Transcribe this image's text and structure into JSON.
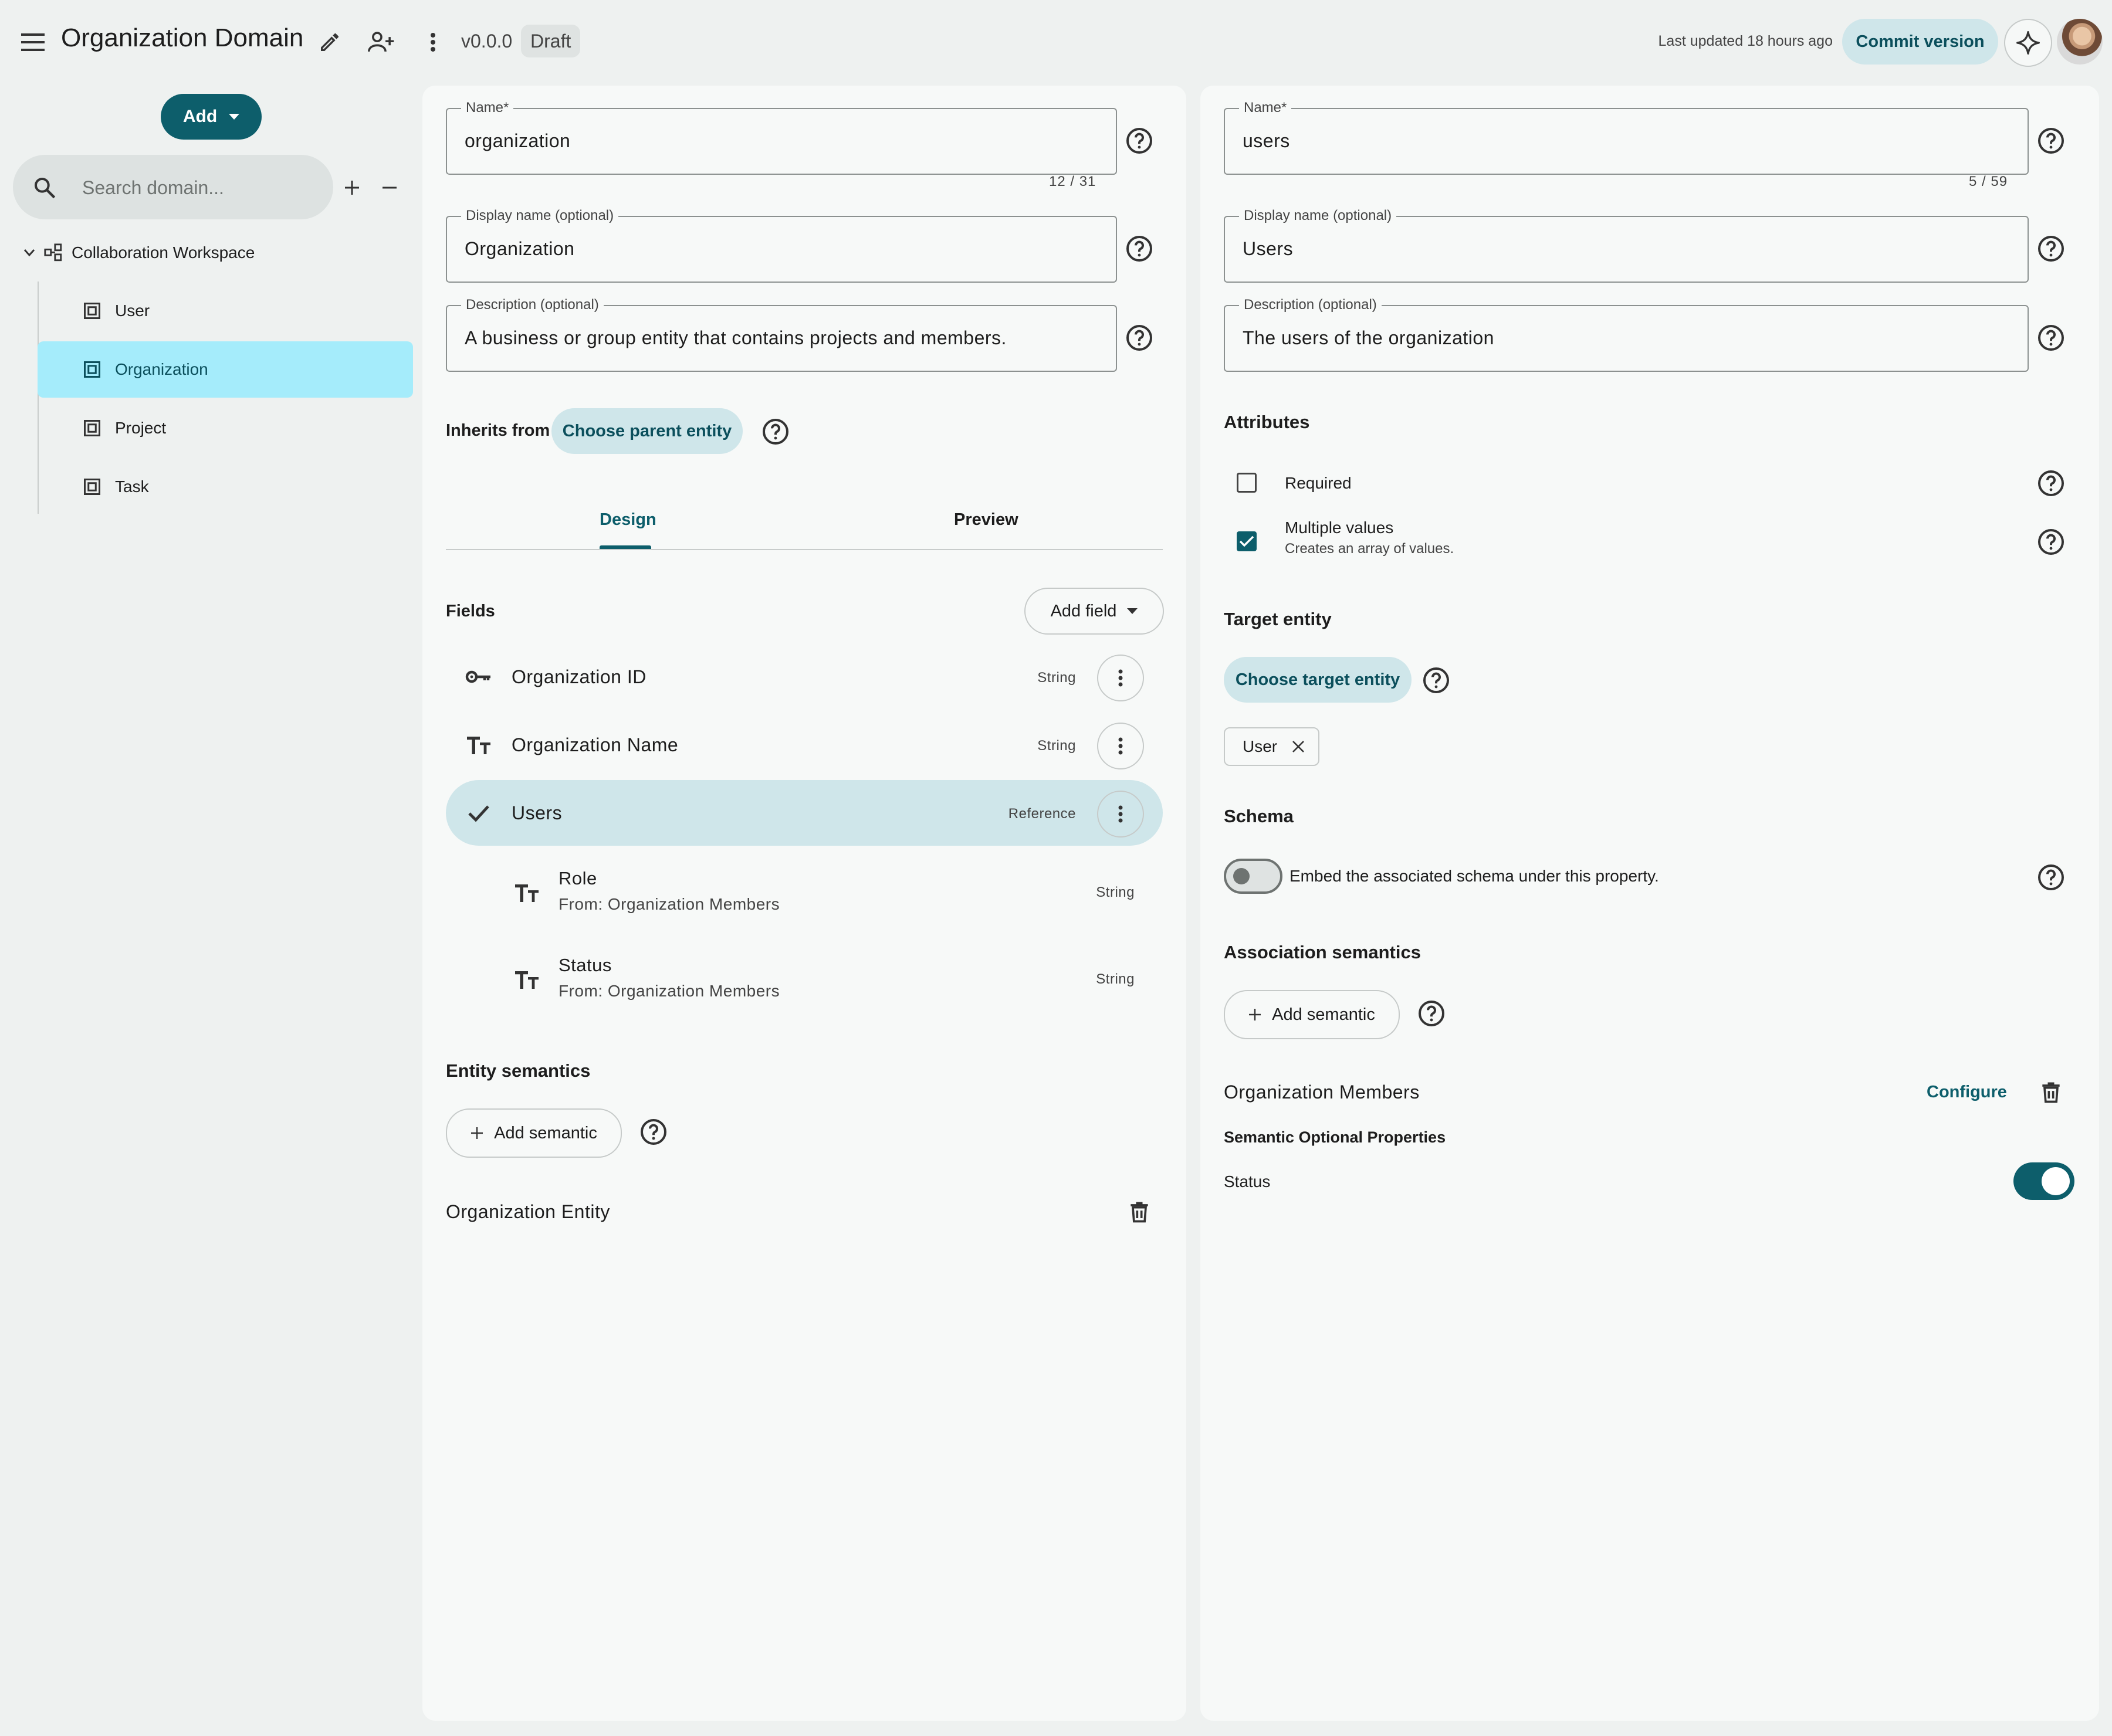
{
  "header": {
    "title": "Organization Domain",
    "version": "v0.0.0",
    "status_badge": "Draft",
    "last_updated": "Last updated 18 hours ago",
    "commit_label": "Commit version"
  },
  "sidebar": {
    "add_label": "Add",
    "search_placeholder": "Search domain...",
    "root_label": "Collaboration Workspace",
    "items": [
      {
        "label": "User"
      },
      {
        "label": "Organization",
        "selected": true
      },
      {
        "label": "Project"
      },
      {
        "label": "Task"
      }
    ]
  },
  "entity_panel": {
    "name_label": "Name*",
    "name_value": "organization",
    "name_counter": "12 / 31",
    "display_label": "Display name (optional)",
    "display_value": "Organization",
    "description_label": "Description (optional)",
    "description_value": "A business or group entity that contains projects and members.",
    "inherits_label": "Inherits from",
    "choose_parent_label": "Choose parent entity",
    "tabs": [
      {
        "label": "Design",
        "active": true
      },
      {
        "label": "Preview",
        "active": false
      }
    ],
    "fields_label": "Fields",
    "add_field_label": "Add field",
    "fields": [
      {
        "name": "Organization ID",
        "type": "String",
        "icon": "key-icon"
      },
      {
        "name": "Organization Name",
        "type": "String",
        "icon": "text-type-icon"
      },
      {
        "name": "Users",
        "type": "Reference",
        "icon": "check-icon",
        "selected": true
      }
    ],
    "sub_fields": [
      {
        "name": "Role",
        "from": "From: Organization Members",
        "type": "String"
      },
      {
        "name": "Status",
        "from": "From: Organization Members",
        "type": "String"
      }
    ],
    "entity_semantics_label": "Entity semantics",
    "add_semantic_label": "Add semantic",
    "semantic_name": "Organization Entity"
  },
  "property_panel": {
    "name_label": "Name*",
    "name_value": "users",
    "name_counter": "5 / 59",
    "display_label": "Display name (optional)",
    "display_value": "Users",
    "description_label": "Description (optional)",
    "description_value": "The users of the organization",
    "attributes_label": "Attributes",
    "required_label": "Required",
    "required_checked": false,
    "multiple_label": "Multiple values",
    "multiple_help": "Creates an array of values.",
    "multiple_checked": true,
    "target_entity_label": "Target entity",
    "choose_target_label": "Choose target entity",
    "target_chip": "User",
    "schema_label": "Schema",
    "embed_label": "Embed the associated schema under this property.",
    "embed_on": false,
    "association_label": "Association semantics",
    "add_semantic_label": "Add semantic",
    "semantic_name": "Organization Members",
    "configure_label": "Configure",
    "optional_props_label": "Semantic Optional Properties",
    "status_label": "Status",
    "status_on": true
  },
  "colors": {
    "accent": "#0d5e6b",
    "selected_row": "#cfe6ea",
    "selected_tree": "#a5ecfb",
    "background": "#eef1f0",
    "panel": "#f7f9f8"
  }
}
